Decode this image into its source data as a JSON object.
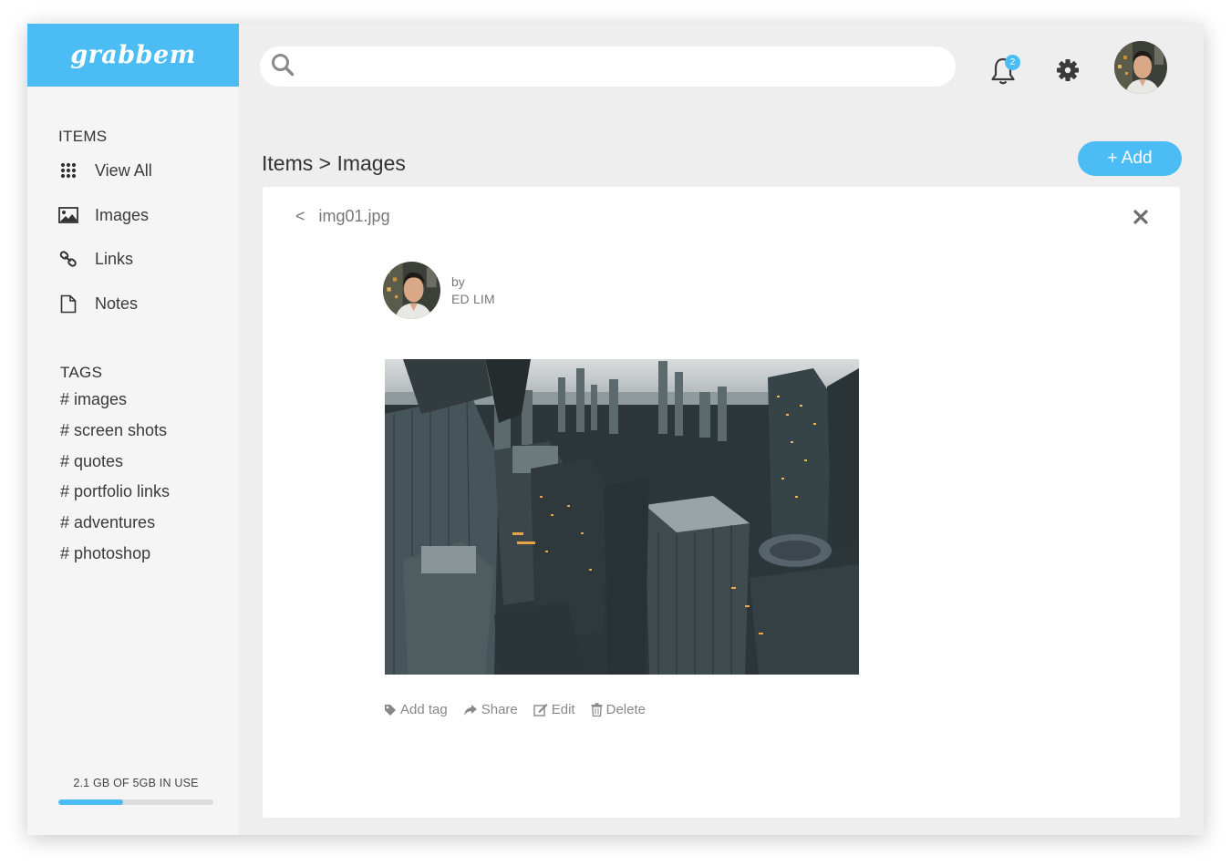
{
  "app": {
    "logo": "grabbem"
  },
  "sidebar": {
    "items_title": "ITEMS",
    "items": [
      {
        "label": "View All",
        "icon": "grid-icon"
      },
      {
        "label": "Images",
        "icon": "image-icon"
      },
      {
        "label": "Links",
        "icon": "link-icon"
      },
      {
        "label": "Notes",
        "icon": "note-icon"
      }
    ],
    "tags_title": "TAGS",
    "tags": [
      "# images",
      "# screen shots",
      "# quotes",
      "# portfolio links",
      "# adventures",
      "# photoshop"
    ],
    "storage": {
      "label": "2.1 GB OF 5GB IN USE",
      "used_fraction": 0.42
    }
  },
  "header": {
    "search_placeholder": "",
    "notification_count": "2"
  },
  "main": {
    "breadcrumb": "Items > Images",
    "add_label": "+ Add",
    "detail": {
      "back_symbol": "<",
      "file_name": "img01.jpg",
      "by_label": "by",
      "author": "ED LIM",
      "actions": [
        "Add tag",
        "Share",
        "Edit",
        "Delete"
      ]
    }
  },
  "colors": {
    "accent": "#4bbcf4",
    "background": "#eeeeee",
    "sidebar": "#f5f5f5"
  }
}
